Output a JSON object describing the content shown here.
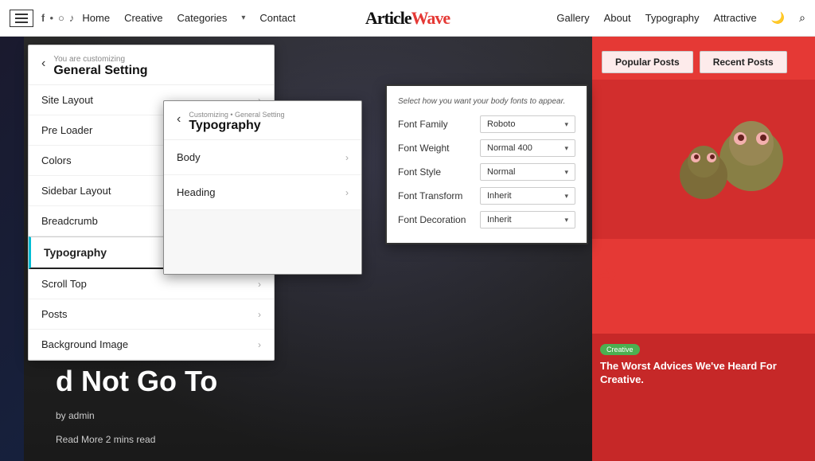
{
  "navbar": {
    "hamburger_label": "menu",
    "social_icons": [
      "f",
      "b",
      "i",
      "t"
    ],
    "links": [
      "Home",
      "Creative",
      "Categories",
      "Contact"
    ],
    "logo_text": "Article",
    "logo_wave": "Wave",
    "right_links": [
      "Gallery",
      "About",
      "Typography",
      "Attractive"
    ],
    "categories_arrow": "▾"
  },
  "hero": {
    "text": "d Not Go To",
    "by": "by admin",
    "readmore": "Read More  2 mins read"
  },
  "sidebar": {
    "popular_posts": "Popular Posts",
    "recent_posts": "Recent Posts",
    "creative_badge": "Creative",
    "card_text": "The Worst Advices We've Heard For Creative."
  },
  "panel_general": {
    "back_label": "‹",
    "subtitle": "You are customizing",
    "title": "General Setting",
    "items": [
      {
        "label": "Site Layout",
        "active": false
      },
      {
        "label": "Pre Loader",
        "active": false
      },
      {
        "label": "Colors",
        "active": false
      },
      {
        "label": "Sidebar Layout",
        "active": false
      },
      {
        "label": "Breadcrumb",
        "active": false
      },
      {
        "label": "Typography",
        "active": true
      },
      {
        "label": "Scroll Top",
        "active": false
      },
      {
        "label": "Posts",
        "active": false
      },
      {
        "label": "Background Image",
        "active": false
      }
    ]
  },
  "panel_typography": {
    "back_label": "‹",
    "breadcrumb": "Customizing • General Setting",
    "title": "Typography",
    "items": [
      {
        "label": "Body"
      },
      {
        "label": "Heading"
      }
    ]
  },
  "panel_fontstyle": {
    "description": "Select how you want your body fonts to appear.",
    "rows": [
      {
        "label": "Font Family",
        "value": "Roboto"
      },
      {
        "label": "Font Weight",
        "value": "Normal 400"
      },
      {
        "label": "Font Style",
        "value": "Normal"
      },
      {
        "label": "Font Transform",
        "value": "Inherit"
      },
      {
        "label": "Font Decoration",
        "value": "Inherit"
      }
    ]
  },
  "arrows": {
    "arrow1": "➜",
    "arrow2": "➜"
  }
}
